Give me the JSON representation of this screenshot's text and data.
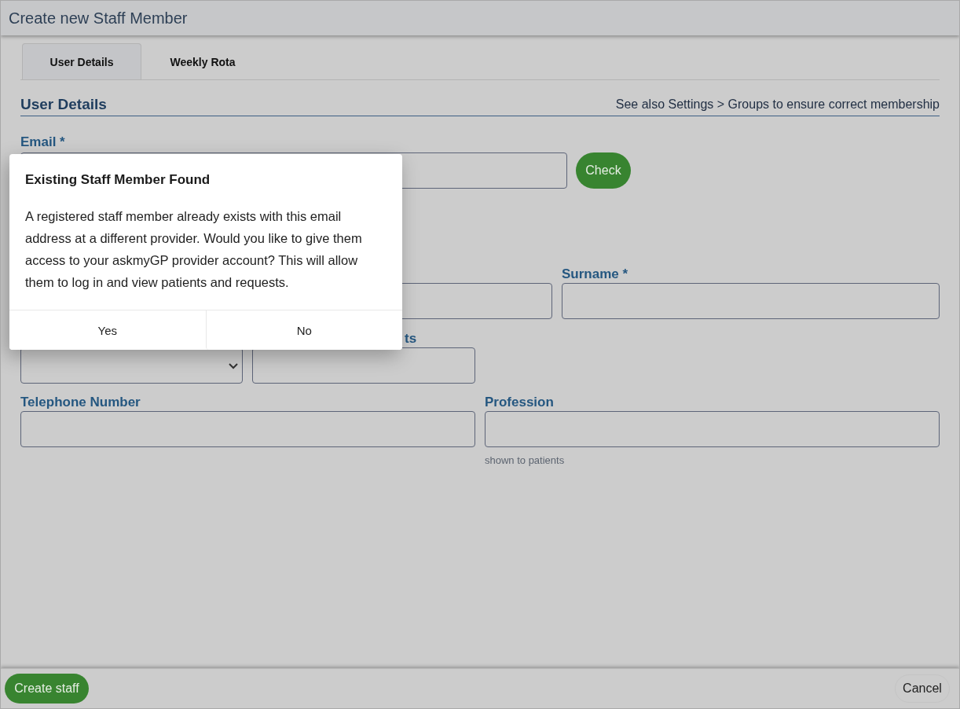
{
  "window": {
    "title": "Create new Staff Member"
  },
  "tabs": [
    {
      "label": "User Details",
      "selected": true
    },
    {
      "label": "Weekly Rota",
      "selected": false
    }
  ],
  "section": {
    "title": "User Details",
    "note": "See also Settings > Groups to ensure correct membership"
  },
  "email": {
    "label": "Email *",
    "button": "Check"
  },
  "rows": [
    {
      "fields": [
        {
          "kind": "input"
        },
        {
          "kind": "input",
          "label": "Surname *"
        }
      ]
    },
    {
      "fields": [
        {
          "kind": "select"
        },
        {
          "kind": "input",
          "label": "ts"
        }
      ]
    },
    {
      "fields": [
        {
          "kind": "input",
          "label": "Telephone Number"
        },
        {
          "kind": "input",
          "label": "Profession",
          "hint": "shown to patients"
        }
      ]
    }
  ],
  "dialog": {
    "title": "Existing Staff Member Found",
    "message": "A registered staff member already exists with this email address at a different provider. Would you like to give them access to your askmyGP provider account? This will allow them to log in and view patients and requests.",
    "buttons": [
      "Yes",
      "No"
    ]
  },
  "footer": {
    "primary": "Create staff",
    "cancel": "Cancel"
  }
}
